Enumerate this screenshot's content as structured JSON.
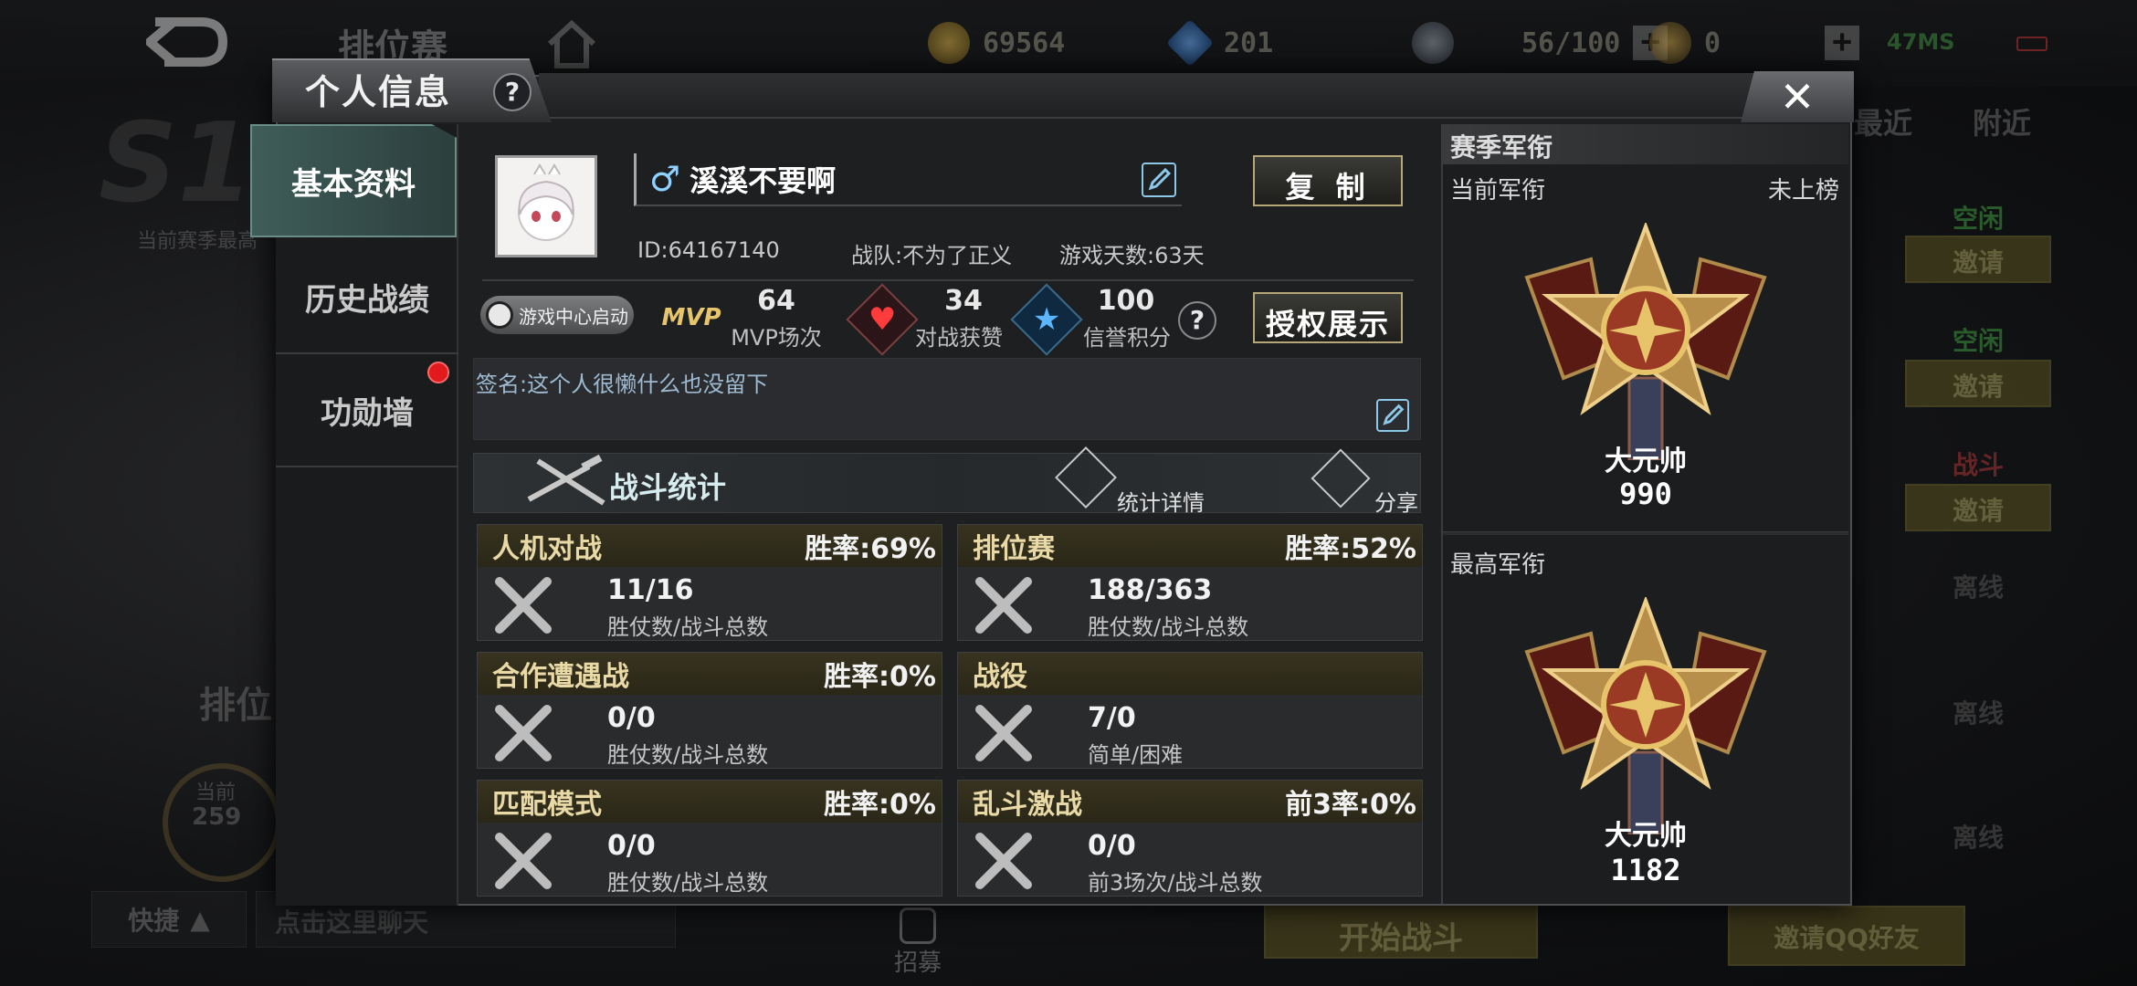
{
  "background": {
    "mode_title": "排位赛",
    "season_badge": "S1",
    "season_sub": "当前赛季最高",
    "gold": "69564",
    "diamonds": "201",
    "stamina": "56/100",
    "tickets": "0",
    "ping": "47MS",
    "tabs": [
      "最近",
      "附近"
    ],
    "friend_status": [
      "空闲",
      "空闲",
      "战斗",
      "离线",
      "离线",
      "离线"
    ],
    "invite_label": "邀请",
    "rank_label": "排位",
    "current_label": "当前",
    "current_value": "259",
    "quick_label": "快捷",
    "chat_placeholder": "点击这里聊天",
    "recruit_label": "招募",
    "start_battle": "开始战斗",
    "invite_qq": "邀请QQ好友"
  },
  "dialog": {
    "title": "个人信息",
    "help_icon": "question-icon",
    "close_icon": "close-icon"
  },
  "nav": {
    "items": [
      {
        "label": "基本资料",
        "active": true
      },
      {
        "label": "历史战绩",
        "active": false
      },
      {
        "label": "功勋墙",
        "active": false,
        "badge": true
      }
    ]
  },
  "profile": {
    "gender_icon": "male-icon",
    "name": "溪溪不要啊",
    "copy_label": "复 制",
    "id_text": "ID:64167140",
    "team_text": "战队:不为了正义",
    "days_text": "游戏天数:63天",
    "launch_label": "游戏中心启动",
    "stats": [
      {
        "icon": "mvp-icon",
        "icon_text": "MVP",
        "value": "64",
        "label": "MVP场次"
      },
      {
        "icon": "heart-icon",
        "value": "34",
        "label": "对战获赞"
      },
      {
        "icon": "star-icon",
        "value": "100",
        "label": "信誉积分"
      }
    ],
    "authorize_label": "授权展示",
    "signature": "签名:这个人很懒什么也没留下"
  },
  "battle": {
    "title": "战斗统计",
    "details_label": "统计详情",
    "share_label": "分享",
    "cards": [
      {
        "mode": "人机对战",
        "rate": "胜率:69%",
        "value": "11/16",
        "sub": "胜仗数/战斗总数"
      },
      {
        "mode": "排位赛",
        "rate": "胜率:52%",
        "value": "188/363",
        "sub": "胜仗数/战斗总数"
      },
      {
        "mode": "合作遭遇战",
        "rate": "胜率:0%",
        "value": "0/0",
        "sub": "胜仗数/战斗总数"
      },
      {
        "mode": "战役",
        "rate": "",
        "value": "7/0",
        "sub": "简单/困难"
      },
      {
        "mode": "匹配模式",
        "rate": "胜率:0%",
        "value": "0/0",
        "sub": "胜仗数/战斗总数"
      },
      {
        "mode": "乱斗激战",
        "rate": "前3率:0%",
        "value": "0/0",
        "sub": "前3场次/战斗总数"
      }
    ]
  },
  "rank": {
    "section_title": "赛季军衔",
    "current_label": "当前军衔",
    "board_status": "未上榜",
    "current_rank": "大元帅",
    "current_score": "990",
    "highest_label": "最高军衔",
    "highest_rank": "大元帅",
    "highest_score": "1182"
  }
}
